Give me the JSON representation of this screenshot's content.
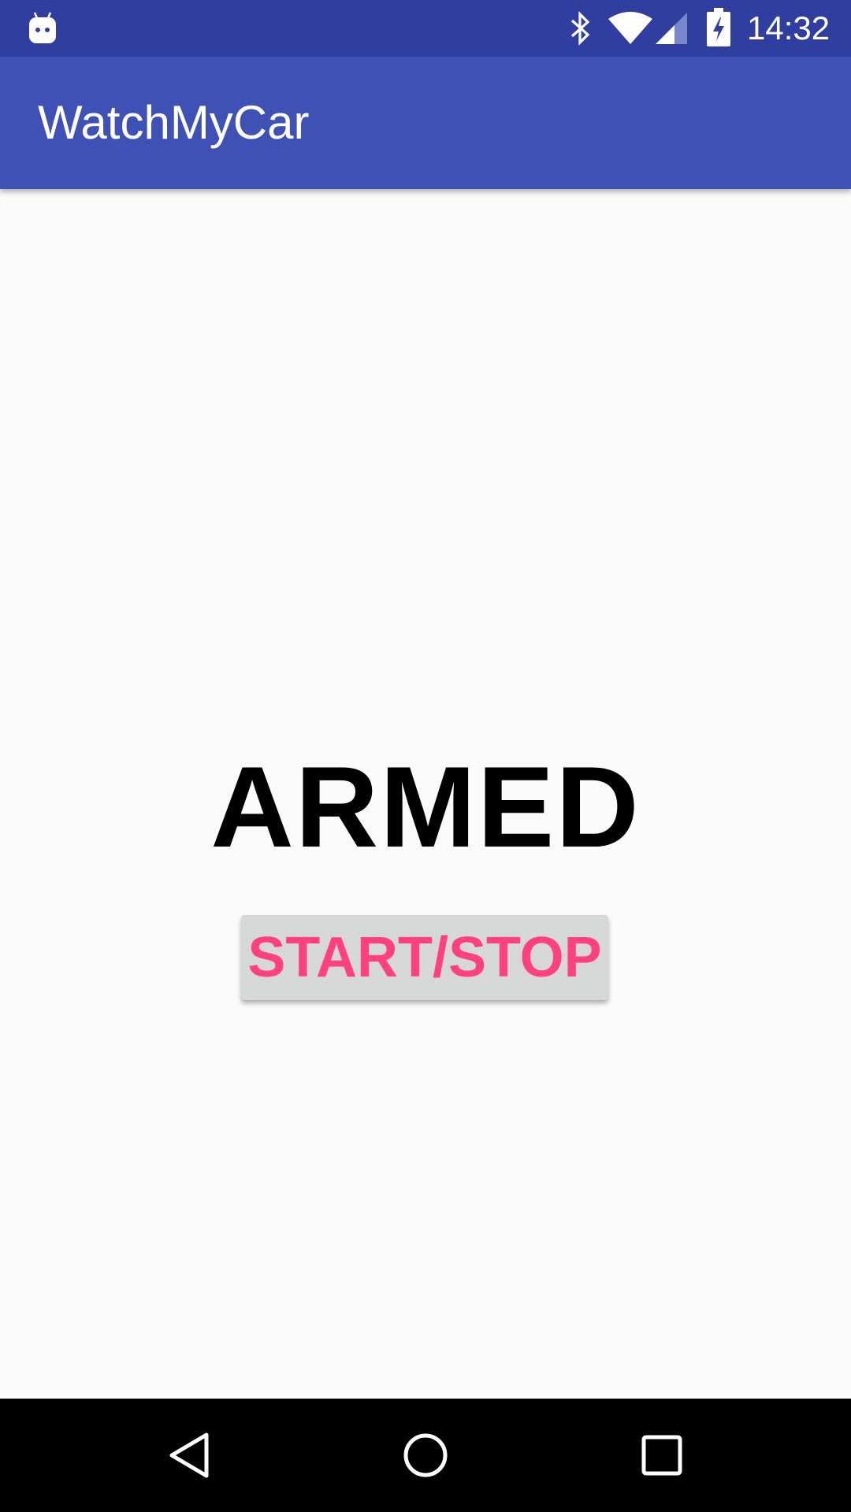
{
  "status_bar": {
    "time": "14:32",
    "icons": [
      "android-notification-icon",
      "bluetooth-icon",
      "wifi-icon",
      "cell-signal-icon",
      "battery-charging-icon"
    ]
  },
  "app_bar": {
    "title": "WatchMyCar"
  },
  "main": {
    "status_text": "ARMED",
    "start_stop_label": "START/STOP"
  },
  "navigation_bar": {
    "buttons": [
      "back-icon",
      "home-icon",
      "recents-icon"
    ]
  },
  "colors": {
    "status_bar": "#303f9f",
    "app_bar": "#3f51b5",
    "background": "#fafafa",
    "button_background": "#d6d7d7",
    "accent": "#ff4081",
    "nav_bar": "#000000"
  }
}
